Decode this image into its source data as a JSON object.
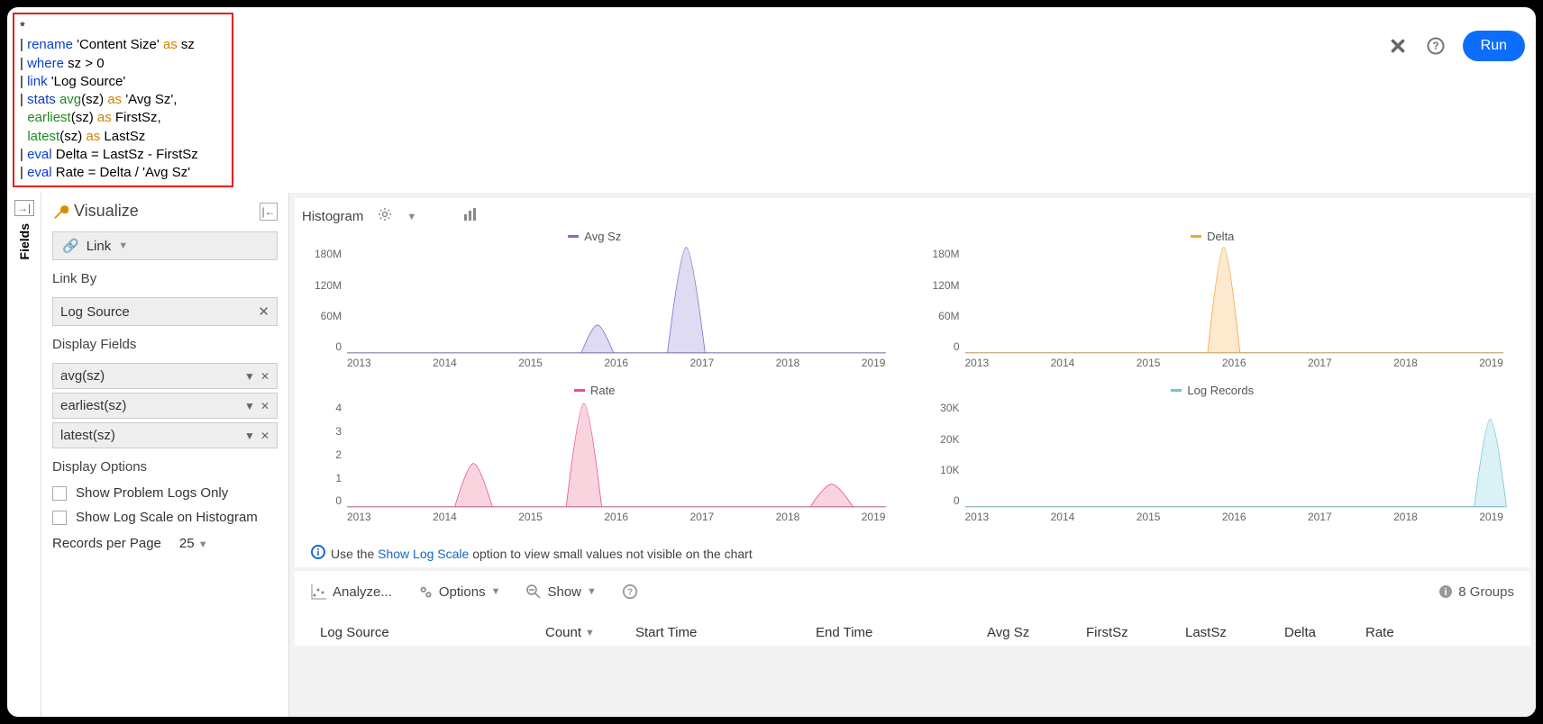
{
  "query": {
    "l0": "*",
    "l1_cmd": "rename",
    "l1_s": "'Content Size'",
    "l1_as": "as",
    "l1_v": "sz",
    "l2_cmd": "where",
    "l2_v": "sz > 0",
    "l3_cmd": "link",
    "l3_v": "'Log Source'",
    "l4_cmd": "stats",
    "l4_f1": "avg",
    "l4_a1": "(sz)",
    "l4_as": "as",
    "l4_r1": "'Avg Sz',",
    "l5_f": "earliest",
    "l5_a": "(sz)",
    "l5_as": "as",
    "l5_r": "FirstSz,",
    "l6_f": "latest",
    "l6_a": "(sz)",
    "l6_as": "as",
    "l6_r": "LastSz",
    "l7_cmd": "eval",
    "l7_v": "Delta = LastSz - FirstSz",
    "l8_cmd": "eval",
    "l8_v": "Rate = Delta / 'Avg Sz'"
  },
  "topbar": {
    "run": "Run"
  },
  "rail": {
    "fields": "Fields"
  },
  "side": {
    "title": "Visualize",
    "mode": "Link",
    "linkby_label": "Link By",
    "linkby_value": "Log Source",
    "display_fields_label": "Display Fields",
    "fields": [
      "avg(sz)",
      "earliest(sz)",
      "latest(sz)"
    ],
    "display_options_label": "Display Options",
    "opt1": "Show Problem Logs Only",
    "opt2": "Show Log Scale on Histogram",
    "rpp_label": "Records per Page",
    "rpp_value": "25"
  },
  "hist": {
    "label": "Histogram"
  },
  "info": {
    "pre": "Use the ",
    "link": "Show Log Scale",
    "post": " option to view small values not visible on the chart"
  },
  "toolbar": {
    "analyze": "Analyze...",
    "options": "Options",
    "show": "Show",
    "groups": "8 Groups"
  },
  "table_cols": {
    "ls": "Log Source",
    "count": "Count",
    "start": "Start Time",
    "end": "End Time",
    "avg": "Avg Sz",
    "first": "FirstSz",
    "last": "LastSz",
    "delta": "Delta",
    "rate": "Rate"
  },
  "chart_data": [
    {
      "type": "area",
      "title": "Avg Sz",
      "color": "#7a6fd1",
      "x": [
        "2013",
        "2014",
        "2015",
        "2016",
        "2017",
        "2018",
        "2019"
      ],
      "ylim": [
        0,
        180000000
      ],
      "yticks": [
        "180M",
        "120M",
        "60M",
        "0"
      ],
      "peaks": [
        {
          "center_x": 0.465,
          "half_width": 0.03,
          "height": 0.27
        },
        {
          "center_x": 0.63,
          "half_width": 0.035,
          "height": 1.02
        }
      ]
    },
    {
      "type": "area",
      "title": "Delta",
      "color": "#f2a73b",
      "x": [
        "2013",
        "2014",
        "2015",
        "2016",
        "2017",
        "2018",
        "2019"
      ],
      "ylim": [
        0,
        180000000
      ],
      "yticks": [
        "180M",
        "120M",
        "60M",
        "0"
      ],
      "peaks": [
        {
          "center_x": 0.48,
          "half_width": 0.03,
          "height": 1.02
        }
      ]
    },
    {
      "type": "area",
      "title": "Rate",
      "color": "#e75480",
      "x": [
        "2013",
        "2014",
        "2015",
        "2016",
        "2017",
        "2018",
        "2019"
      ],
      "ylim": [
        0,
        4
      ],
      "yticks": [
        "4",
        "3",
        "2",
        "1",
        "0"
      ],
      "peaks": [
        {
          "center_x": 0.235,
          "half_width": 0.035,
          "height": 0.42
        },
        {
          "center_x": 0.44,
          "half_width": 0.033,
          "height": 1.0
        },
        {
          "center_x": 0.9,
          "half_width": 0.04,
          "height": 0.22
        }
      ]
    },
    {
      "type": "area",
      "title": "Log Records",
      "color": "#6cc6d9",
      "x": [
        "2013",
        "2014",
        "2015",
        "2016",
        "2017",
        "2018",
        "2019"
      ],
      "ylim": [
        0,
        30000
      ],
      "yticks": [
        "30K",
        "20K",
        "10K",
        "0"
      ],
      "peaks": [
        {
          "center_x": 0.975,
          "half_width": 0.03,
          "height": 0.85
        }
      ]
    }
  ]
}
